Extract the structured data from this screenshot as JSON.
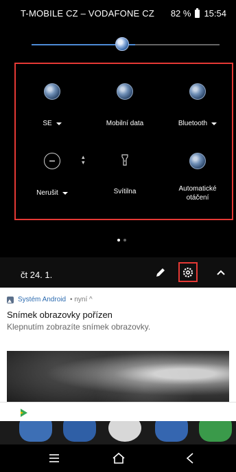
{
  "status_bar": {
    "carrier": "T-MOBILE CZ – VODAFONE CZ",
    "battery": "82 %",
    "time": "15:54"
  },
  "brightness": {
    "level": 0.55
  },
  "quick_settings": {
    "tiles": [
      {
        "label": "SE",
        "icon": "wifi-icon",
        "has_dropdown": true,
        "active": true
      },
      {
        "label": "Mobilní data",
        "icon": "mobile-data-icon",
        "has_dropdown": false,
        "active": true
      },
      {
        "label": "Bluetooth",
        "icon": "bluetooth-icon",
        "has_dropdown": true,
        "active": true
      },
      {
        "label": "Nerušit",
        "icon": "do-not-disturb-icon",
        "has_dropdown": true,
        "active": false
      },
      {
        "label": "Svítilna",
        "icon": "flashlight-icon",
        "has_dropdown": false,
        "active": false
      },
      {
        "label": "Automatické otáčení",
        "icon": "auto-rotate-icon",
        "has_dropdown": false,
        "active": true
      }
    ],
    "page_count": 2,
    "current_page": 1
  },
  "footer": {
    "date": "čt 24. 1."
  },
  "notification": {
    "app_name": "Systém Android",
    "meta": "• nyní ^",
    "title": "Snímek obrazovky pořízen",
    "text": "Klepnutím zobrazíte snímek obrazovky."
  },
  "colors": {
    "highlight_border": "#e53935",
    "slider_accent": "#4d8bd6",
    "app_name": "#2c6bb0"
  }
}
